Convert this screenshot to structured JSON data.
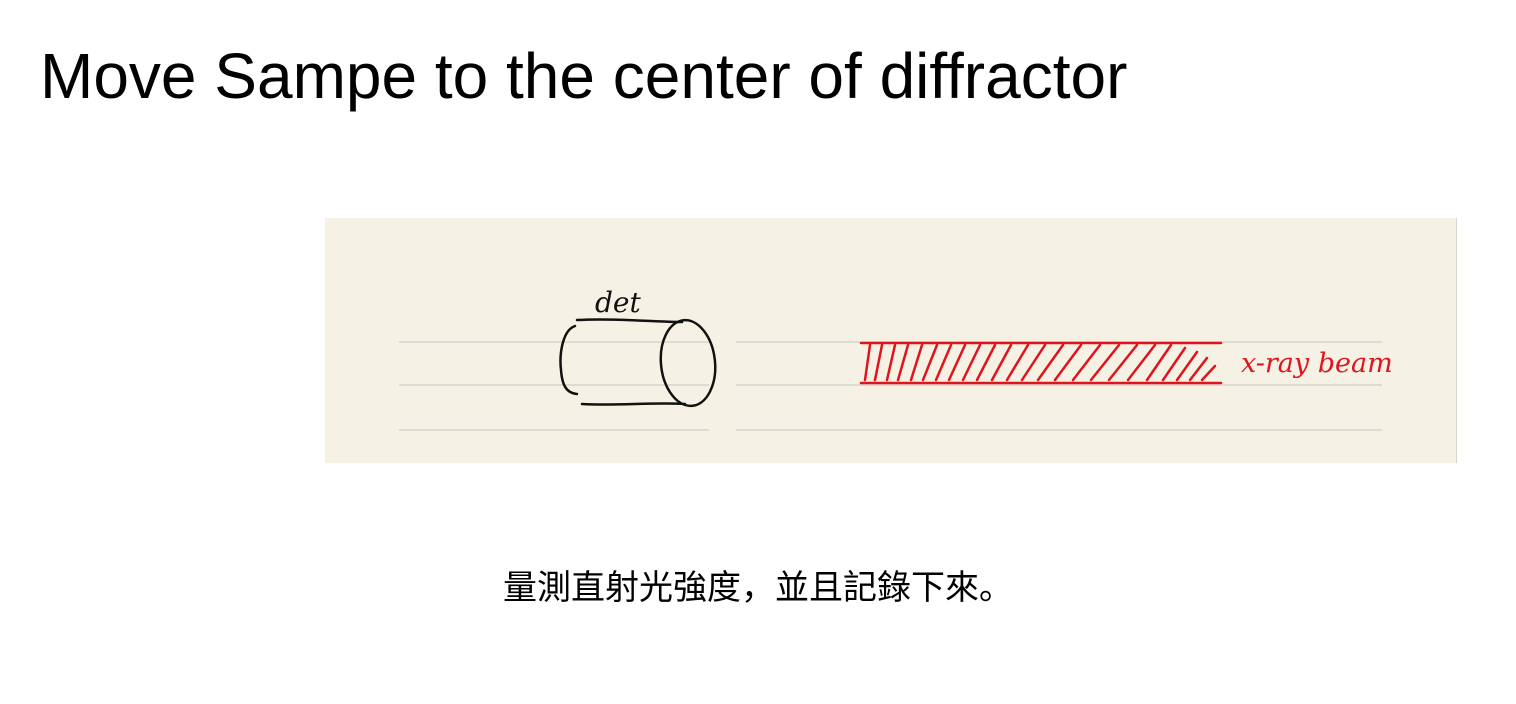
{
  "title": "Move Sampe to the center of diffractor",
  "sketch": {
    "detector_label": "det",
    "beam_label": "x-ray beam",
    "ink_color": "#111111",
    "beam_color": "#e0141c",
    "paper_color": "#f5f2e5",
    "rule_color": "#d6d4cc"
  },
  "caption": "量測直射光強度，並且記錄下來。"
}
